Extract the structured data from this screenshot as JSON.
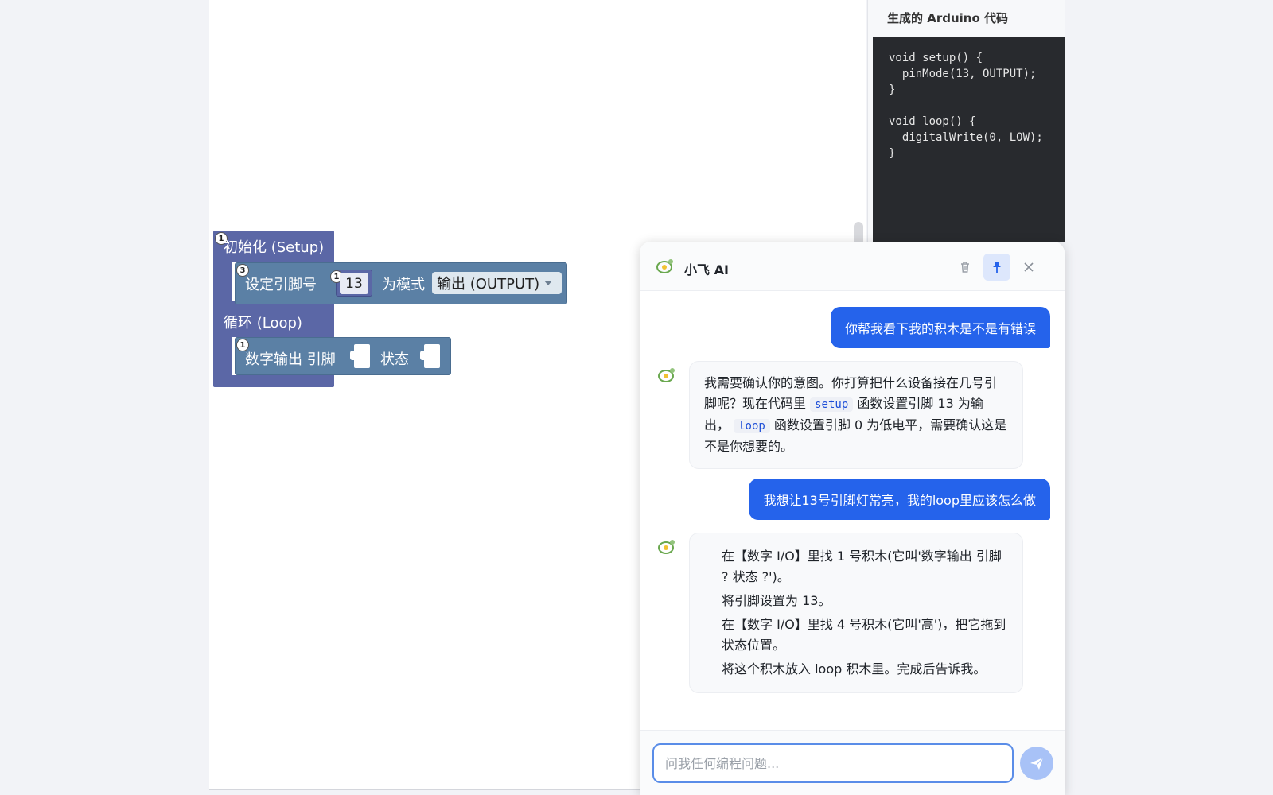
{
  "code_panel": {
    "title": "生成的 Arduino 代码",
    "lines": [
      "void setup() {",
      "  pinMode(13, OUTPUT);",
      "}",
      "",
      "void loop() {",
      "  digitalWrite(0, LOW);",
      "}"
    ]
  },
  "blocks": {
    "setup_title": "初始化 (Setup)",
    "setup_badge": "1",
    "pin_label": "设定引脚号",
    "pin_badge": "3",
    "pin_value": "13",
    "pin_value_badge": "1",
    "mode_label": "为模式",
    "mode_value": "输出 (OUTPUT)",
    "loop_title": "循环 (Loop)",
    "dout_label": "数字输出 引脚",
    "dout_badge": "1",
    "dout_state_label": "状态"
  },
  "chat": {
    "title": "小飞 AI",
    "messages": {
      "user1": "你帮我看下我的积木是不是有错误",
      "ai1": {
        "p1": "我需要确认你的意图。你打算把什么设备接在几号引脚呢？现在代码里",
        "code1": "setup",
        "p2": "函数设置引脚 13 为输出，",
        "code2": "loop",
        "p3": "函数设置引脚 0 为低电平，需要确认这是不是你想要的。"
      },
      "user2": "我想让13号引脚灯常亮，我的loop里应该怎么做",
      "ai2": {
        "step1": "在【数字 I/O】里找 1 号积木(它叫'数字输出 引脚 ? 状态 ?')。",
        "step2": "将引脚设置为 13。",
        "step3": "在【数字 I/O】里找 4 号积木(它叫'高')，把它拖到状态位置。",
        "step4": "将这个积木放入 loop 积木里。完成后告诉我。"
      }
    },
    "input": {
      "placeholder": "问我任何编程问题...",
      "value": ""
    },
    "colors": {
      "accent": "#2563eb",
      "send_disabled": "#a8c2f7"
    }
  },
  "icons": {
    "clear": "trash-icon",
    "pin": "pin-icon",
    "close": "close-icon",
    "send": "send-icon",
    "logo": "xiaofei-logo-icon"
  }
}
